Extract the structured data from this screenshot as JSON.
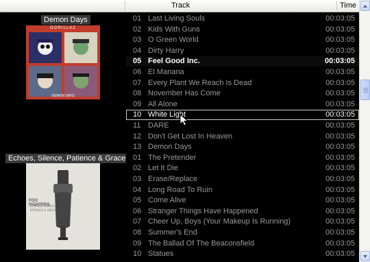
{
  "header": {
    "track_label": "Track",
    "time_label": "Time"
  },
  "albums": [
    {
      "title": "Demon Days",
      "cover_label": "GORILLAZ",
      "cover_caption": "DEMON DAYS"
    },
    {
      "title": "Echoes, Silence, Patience & Grace",
      "cover_label": "FOO FIGHTERS"
    }
  ],
  "tracks": [
    {
      "num": "01",
      "title": "Last Living Souls",
      "time": "00:03:05",
      "state": ""
    },
    {
      "num": "02",
      "title": "Kids With Guns",
      "time": "00:03:05",
      "state": ""
    },
    {
      "num": "03",
      "title": "O Green World",
      "time": "00:03:05",
      "state": ""
    },
    {
      "num": "04",
      "title": "Dirty Harry",
      "time": "00:03:05",
      "state": ""
    },
    {
      "num": "05",
      "title": "Feel Good Inc.",
      "time": "00:03:05",
      "state": "playing"
    },
    {
      "num": "06",
      "title": "El Manana",
      "time": "00:03:05",
      "state": ""
    },
    {
      "num": "07",
      "title": "Every Plant We Reach Is Dead",
      "time": "00:03:05",
      "state": ""
    },
    {
      "num": "08",
      "title": "November Has Come",
      "time": "00:03:05",
      "state": ""
    },
    {
      "num": "09",
      "title": "All Alone",
      "time": "00:03:05",
      "state": ""
    },
    {
      "num": "10",
      "title": "White Light",
      "time": "00:03:05",
      "state": "selected"
    },
    {
      "num": "11",
      "title": "DARE",
      "time": "00:03:05",
      "state": ""
    },
    {
      "num": "12",
      "title": "Don't Get Lost In Heaven",
      "time": "00:03:05",
      "state": ""
    },
    {
      "num": "13",
      "title": "Demon Days",
      "time": "00:03:05",
      "state": ""
    },
    {
      "num": "01",
      "title": "The Pretender",
      "time": "00:03:05",
      "state": ""
    },
    {
      "num": "02",
      "title": "Let It Die",
      "time": "00:03:05",
      "state": ""
    },
    {
      "num": "03",
      "title": "Erase/Replace",
      "time": "00:03:05",
      "state": ""
    },
    {
      "num": "04",
      "title": "Long Road To Ruin",
      "time": "00:03:05",
      "state": ""
    },
    {
      "num": "05",
      "title": "Come Alive",
      "time": "00:03:05",
      "state": ""
    },
    {
      "num": "06",
      "title": "Stranger Things Have Happened",
      "time": "00:03:05",
      "state": ""
    },
    {
      "num": "07",
      "title": "Cheer Up, Boys (Your Makeup Is Running)",
      "time": "00:03:05",
      "state": ""
    },
    {
      "num": "08",
      "title": "Summer's End",
      "time": "00:03:05",
      "state": ""
    },
    {
      "num": "09",
      "title": "The Ballad Of The Beaconsfield",
      "time": "00:03:05",
      "state": ""
    },
    {
      "num": "10",
      "title": "Statues",
      "time": "00:03:05",
      "state": ""
    }
  ],
  "colors": {
    "background": "#000000",
    "row_text": "#9a9a9a",
    "active_text": "#ffffff"
  }
}
